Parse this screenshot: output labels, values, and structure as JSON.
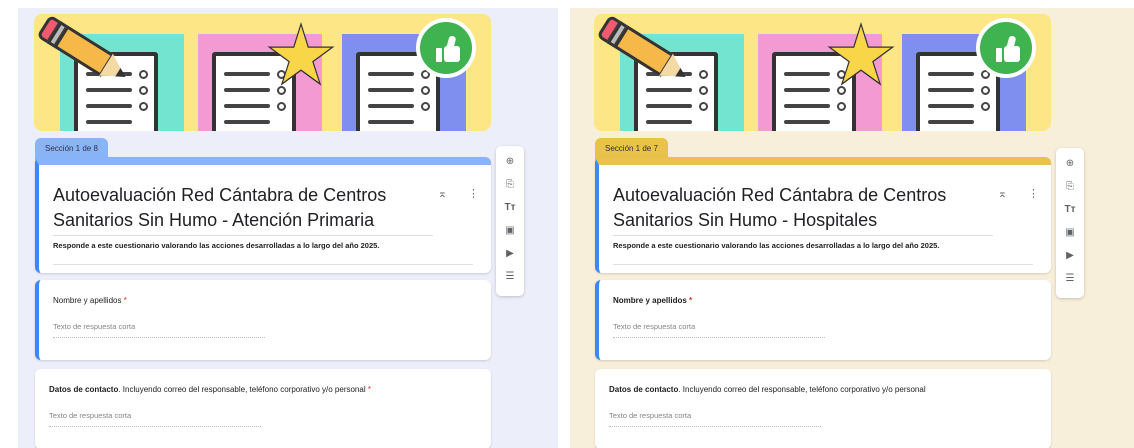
{
  "left": {
    "section_tab": "Sección 1 de 8",
    "title": "Autoevaluación Red Cántabra de Centros Sanitarios Sin Humo - Atención Primaria",
    "description": "Responde a este cuestionario valorando las acciones desarrolladas a lo largo del año 2025.",
    "accent_color": "#8ab4f8",
    "questions": [
      {
        "label": "Nombre y apellidos",
        "required": "*",
        "placeholder": "Texto de respuesta corta"
      },
      {
        "label_bold": "Datos de contacto",
        "label_rest": ". Incluyendo correo del responsable, teléfono corporativo y/o personal",
        "required": "*",
        "placeholder": "Texto de respuesta corta"
      }
    ]
  },
  "right": {
    "section_tab": "Sección 1 de 7",
    "title": "Autoevaluación Red Cántabra de Centros Sanitarios Sin Humo - Hospitales",
    "description": "Responde a este cuestionario valorando las acciones desarrolladas a lo largo del año 2025.",
    "accent_color": "#e8c24a",
    "questions": [
      {
        "label": "Nombre y apellidos",
        "required": "*",
        "placeholder": "Texto de respuesta corta"
      },
      {
        "label_bold": "Datos de contacto",
        "label_rest": ". Incluyendo correo del responsable, teléfono corporativo y/o personal",
        "required": "",
        "placeholder": "Texto de respuesta corta"
      }
    ]
  },
  "card_tools": {
    "collapse_glyph": "⌅",
    "more_glyph": "⋮"
  },
  "toolbar": [
    {
      "icon": "add-question-icon",
      "glyph": "⊕"
    },
    {
      "icon": "import-questions-icon",
      "glyph": "⎘"
    },
    {
      "icon": "add-title-icon",
      "glyph": "Tт"
    },
    {
      "icon": "add-image-icon",
      "glyph": "▣"
    },
    {
      "icon": "add-video-icon",
      "glyph": "▶"
    },
    {
      "icon": "add-section-icon",
      "glyph": "☰"
    }
  ],
  "colors": {
    "sheet_teal": "#73e4cf",
    "sheet_pink": "#f49ad2",
    "sheet_blue": "#7f8ff0",
    "banner": "#fce685"
  }
}
